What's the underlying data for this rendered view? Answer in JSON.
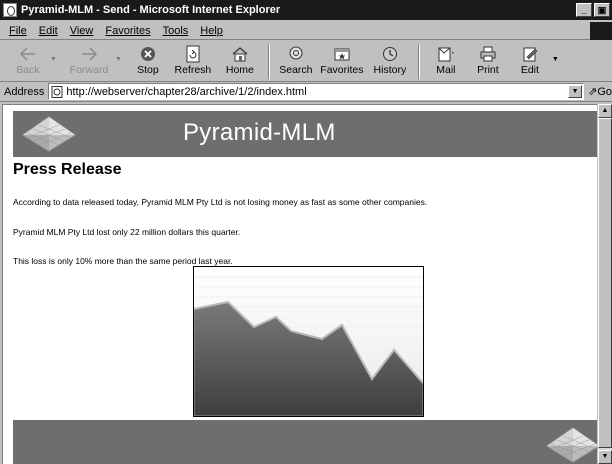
{
  "window": {
    "title": "Pyramid-MLM - Send - Microsoft Internet Explorer",
    "controls": {
      "minimize": "_",
      "maximize": "🗗",
      "close": "×"
    }
  },
  "menu": [
    {
      "label": "File"
    },
    {
      "label": "Edit"
    },
    {
      "label": "View"
    },
    {
      "label": "Favorites"
    },
    {
      "label": "Tools"
    },
    {
      "label": "Help"
    }
  ],
  "toolbar": {
    "back": "Back",
    "forward": "Forward",
    "stop": "Stop",
    "refresh": "Refresh",
    "home": "Home",
    "search": "Search",
    "favorites": "Favorites",
    "history": "History",
    "mail": "Mail",
    "print": "Print",
    "edit": "Edit"
  },
  "address": {
    "label": "Address",
    "url": "http://webserver/chapter28/archive/1/2/index.html",
    "go": "Go"
  },
  "page": {
    "brand": "Pyramid-MLM",
    "heading": "Press Release",
    "paragraphs": [
      "According to data released today, Pyramid MLM Pty Ltd is not losing money as fast as some other companies.",
      "Pyramid MLM Pty Ltd lost only 22 million dollars this quarter.",
      "This loss is only 10% more than the same period last year."
    ]
  },
  "colors": {
    "titlebar": "#1a1a1a",
    "banner": "#6e6e6e",
    "chrome": "#c0c0c0"
  }
}
